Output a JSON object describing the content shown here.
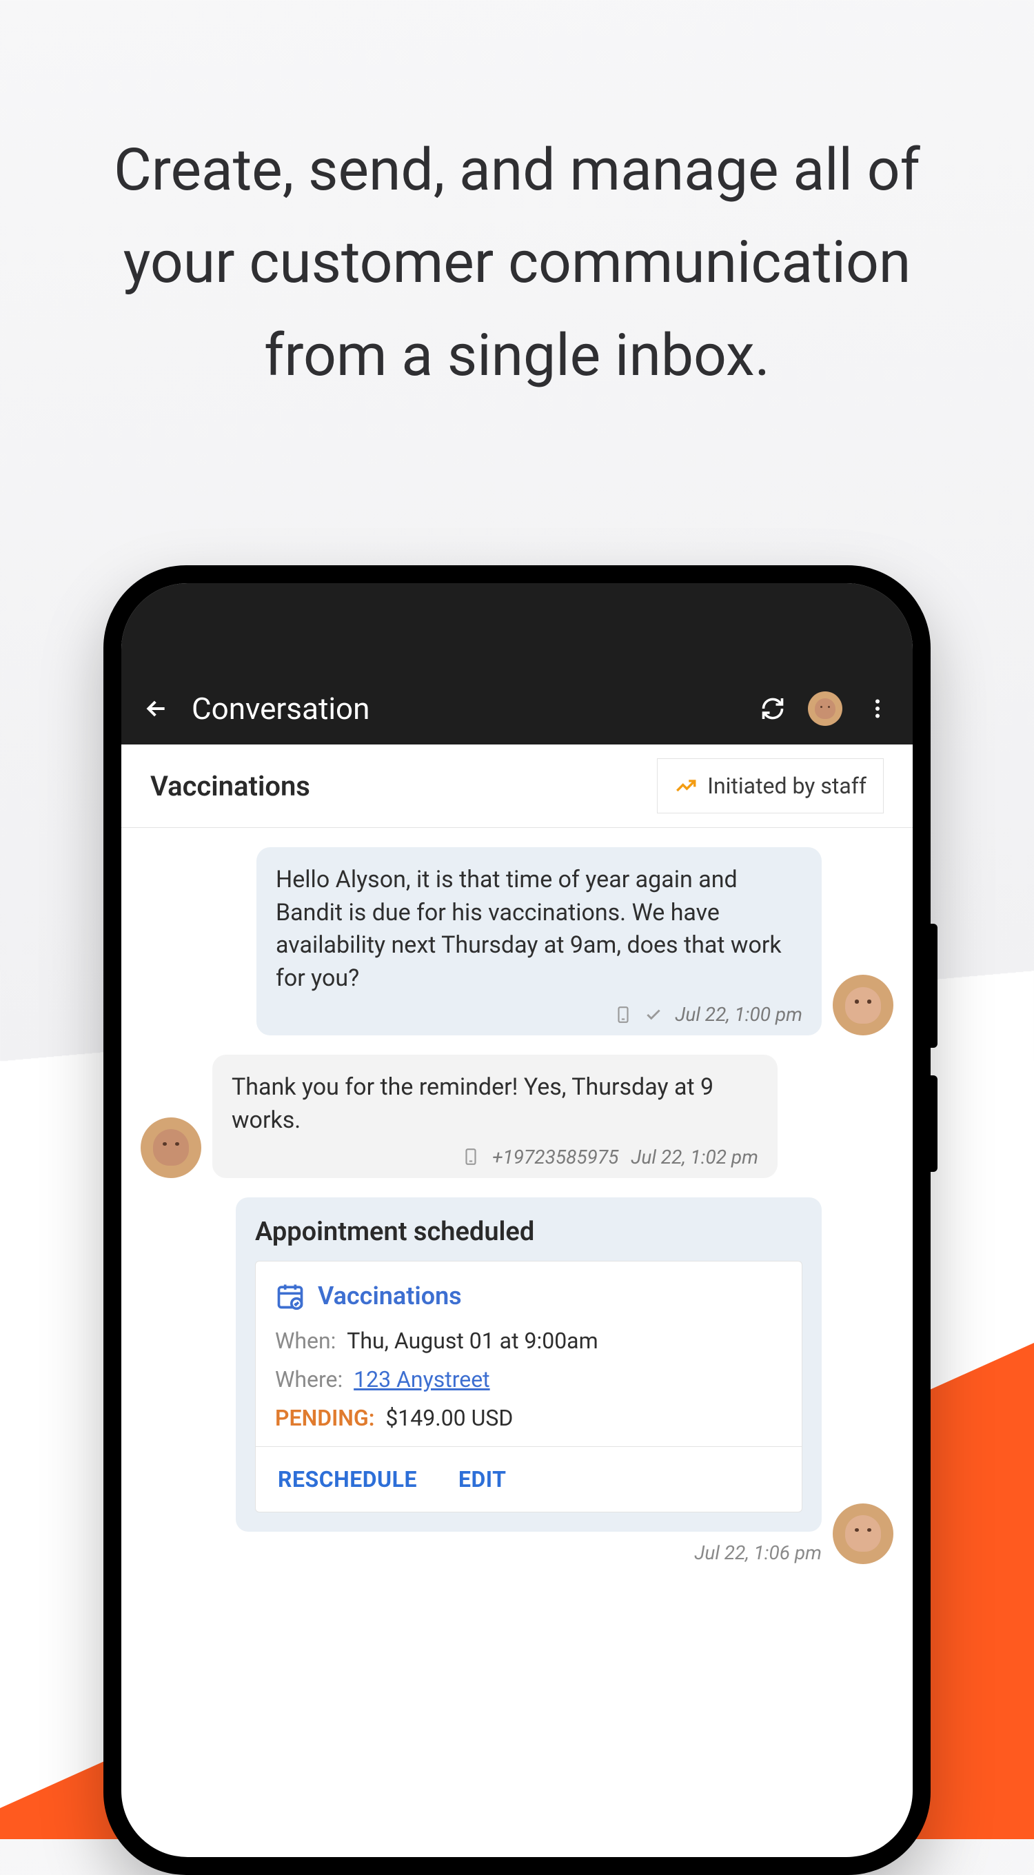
{
  "headline": "Create, send, and manage all of your customer communication from a single inbox.",
  "appbar": {
    "title": "Conversation"
  },
  "subheader": {
    "title": "Vaccinations",
    "chip": "Initiated by staff"
  },
  "messages": {
    "staff1": {
      "text": "Hello Alyson, it is that time of year again and Bandit is due for his vaccinations. We have availability next Thursday at 9am, does that work for you?",
      "time": "Jul 22, 1:00 pm"
    },
    "customer1": {
      "text": "Thank you for the reminder! Yes, Thursday at 9 works.",
      "phone": "+19723585975",
      "time": "Jul 22, 1:02 pm"
    }
  },
  "appointment": {
    "card_title": "Appointment scheduled",
    "type": "Vaccinations",
    "when_label": "When:",
    "when_value": "Thu, August 01 at 9:00am",
    "where_label": "Where:",
    "where_value": "123 Anystreet",
    "status_label": "PENDING:",
    "status_value": "$149.00 USD",
    "reschedule": "RESCHEDULE",
    "edit": "EDIT",
    "time": "Jul 22, 1:06 pm"
  }
}
